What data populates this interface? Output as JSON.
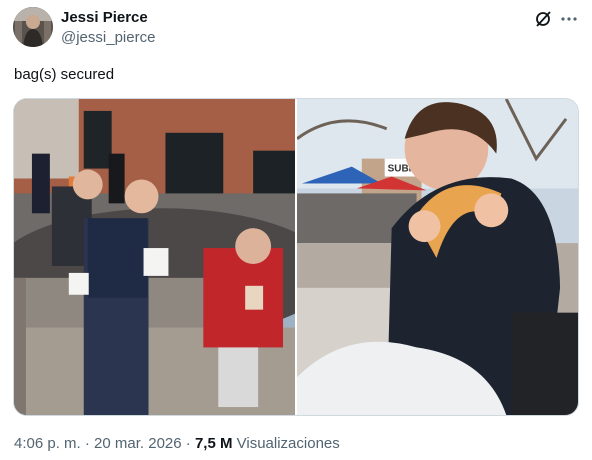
{
  "author": {
    "name": "Jessi Pierce",
    "handle": "@jessi_pierce"
  },
  "tweet": {
    "text": "bag(s) secured"
  },
  "media": {
    "photo_1_sign": "",
    "photo_2_sign": "SUBMARINE"
  },
  "meta": {
    "time": "4:06 p. m.",
    "separator": "·",
    "date": "20 mar. 2026",
    "views_count": "7,5 M",
    "views_label": "Visualizaciones"
  },
  "icons": {
    "grok": "grok-icon",
    "more": "more-dots-icon"
  },
  "colors": {
    "text": "#0f1419",
    "secondary": "#536471",
    "border": "#cfd9de"
  }
}
